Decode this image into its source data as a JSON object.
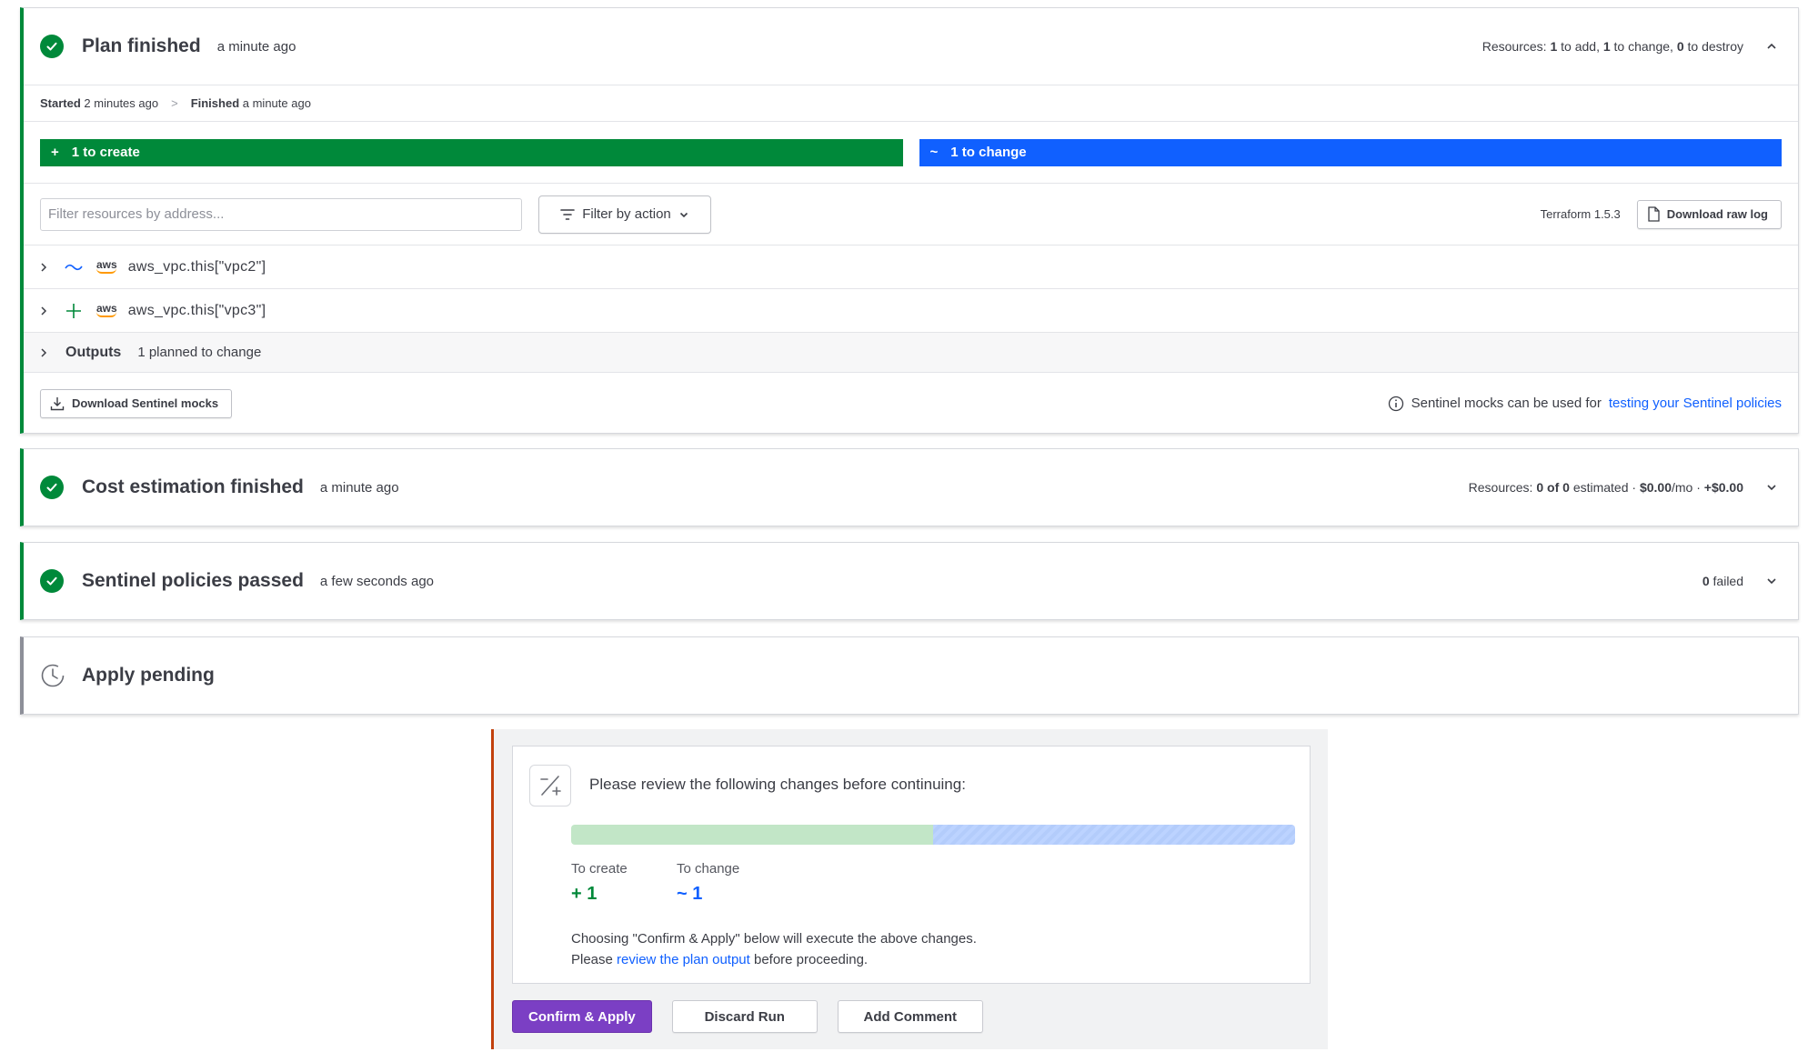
{
  "plan": {
    "title": "Plan finished",
    "ago": "a minute ago",
    "resources_prefix": "Resources:",
    "add_count": "1",
    "add_label": "to add,",
    "change_count": "1",
    "change_label": "to change,",
    "destroy_count": "0",
    "destroy_label": "to destroy",
    "started_label": "Started",
    "started_value": "2 minutes ago",
    "separator": ">",
    "finished_label": "Finished",
    "finished_value": "a minute ago",
    "create_bar": "1 to create",
    "change_bar": "1 to change",
    "create_symbol": "+",
    "change_symbol": "~",
    "search_placeholder": "Filter resources by address...",
    "filter_button": "Filter by action",
    "terraform_version": "Terraform 1.5.3",
    "download_raw_log": "Download raw log",
    "resources": [
      {
        "action": "change",
        "provider": "aws",
        "address": "aws_vpc.this[\"vpc2\"]"
      },
      {
        "action": "create",
        "provider": "aws",
        "address": "aws_vpc.this[\"vpc3\"]"
      }
    ],
    "outputs_label": "Outputs",
    "outputs_sub": "1 planned to change",
    "download_mocks": "Download Sentinel mocks",
    "mocks_info": "Sentinel mocks can be used for",
    "mocks_link": "testing your Sentinel policies"
  },
  "cost": {
    "title": "Cost estimation finished",
    "ago": "a minute ago",
    "resources_prefix": "Resources:",
    "estimated_count": "0 of 0",
    "estimated_label": "estimated ·",
    "monthly": "$0.00",
    "monthly_unit": "/mo ·",
    "delta": "+$0.00"
  },
  "sentinel": {
    "title": "Sentinel policies passed",
    "ago": "a few seconds ago",
    "failed_count": "0",
    "failed_label": "failed"
  },
  "apply": {
    "title": "Apply pending"
  },
  "review": {
    "title": "Please review the following changes before continuing:",
    "create_fraction": 0.5,
    "to_create_label": "To create",
    "to_create_value": "+ 1",
    "to_change_label": "To change",
    "to_change_value": "~ 1",
    "line1": "Choosing \"Confirm & Apply\" below will execute the above changes.",
    "line2_prefix": "Please",
    "line2_link": "review the plan output",
    "line2_suffix": "before proceeding.",
    "confirm_button": "Confirm & Apply",
    "discard_button": "Discard Run",
    "comment_button": "Add Comment"
  },
  "colors": {
    "success": "#00893a",
    "change": "#1060ff",
    "pending": "#8d8f98",
    "primary_button": "#7b3fc4",
    "accent_border": "#c2410c"
  }
}
